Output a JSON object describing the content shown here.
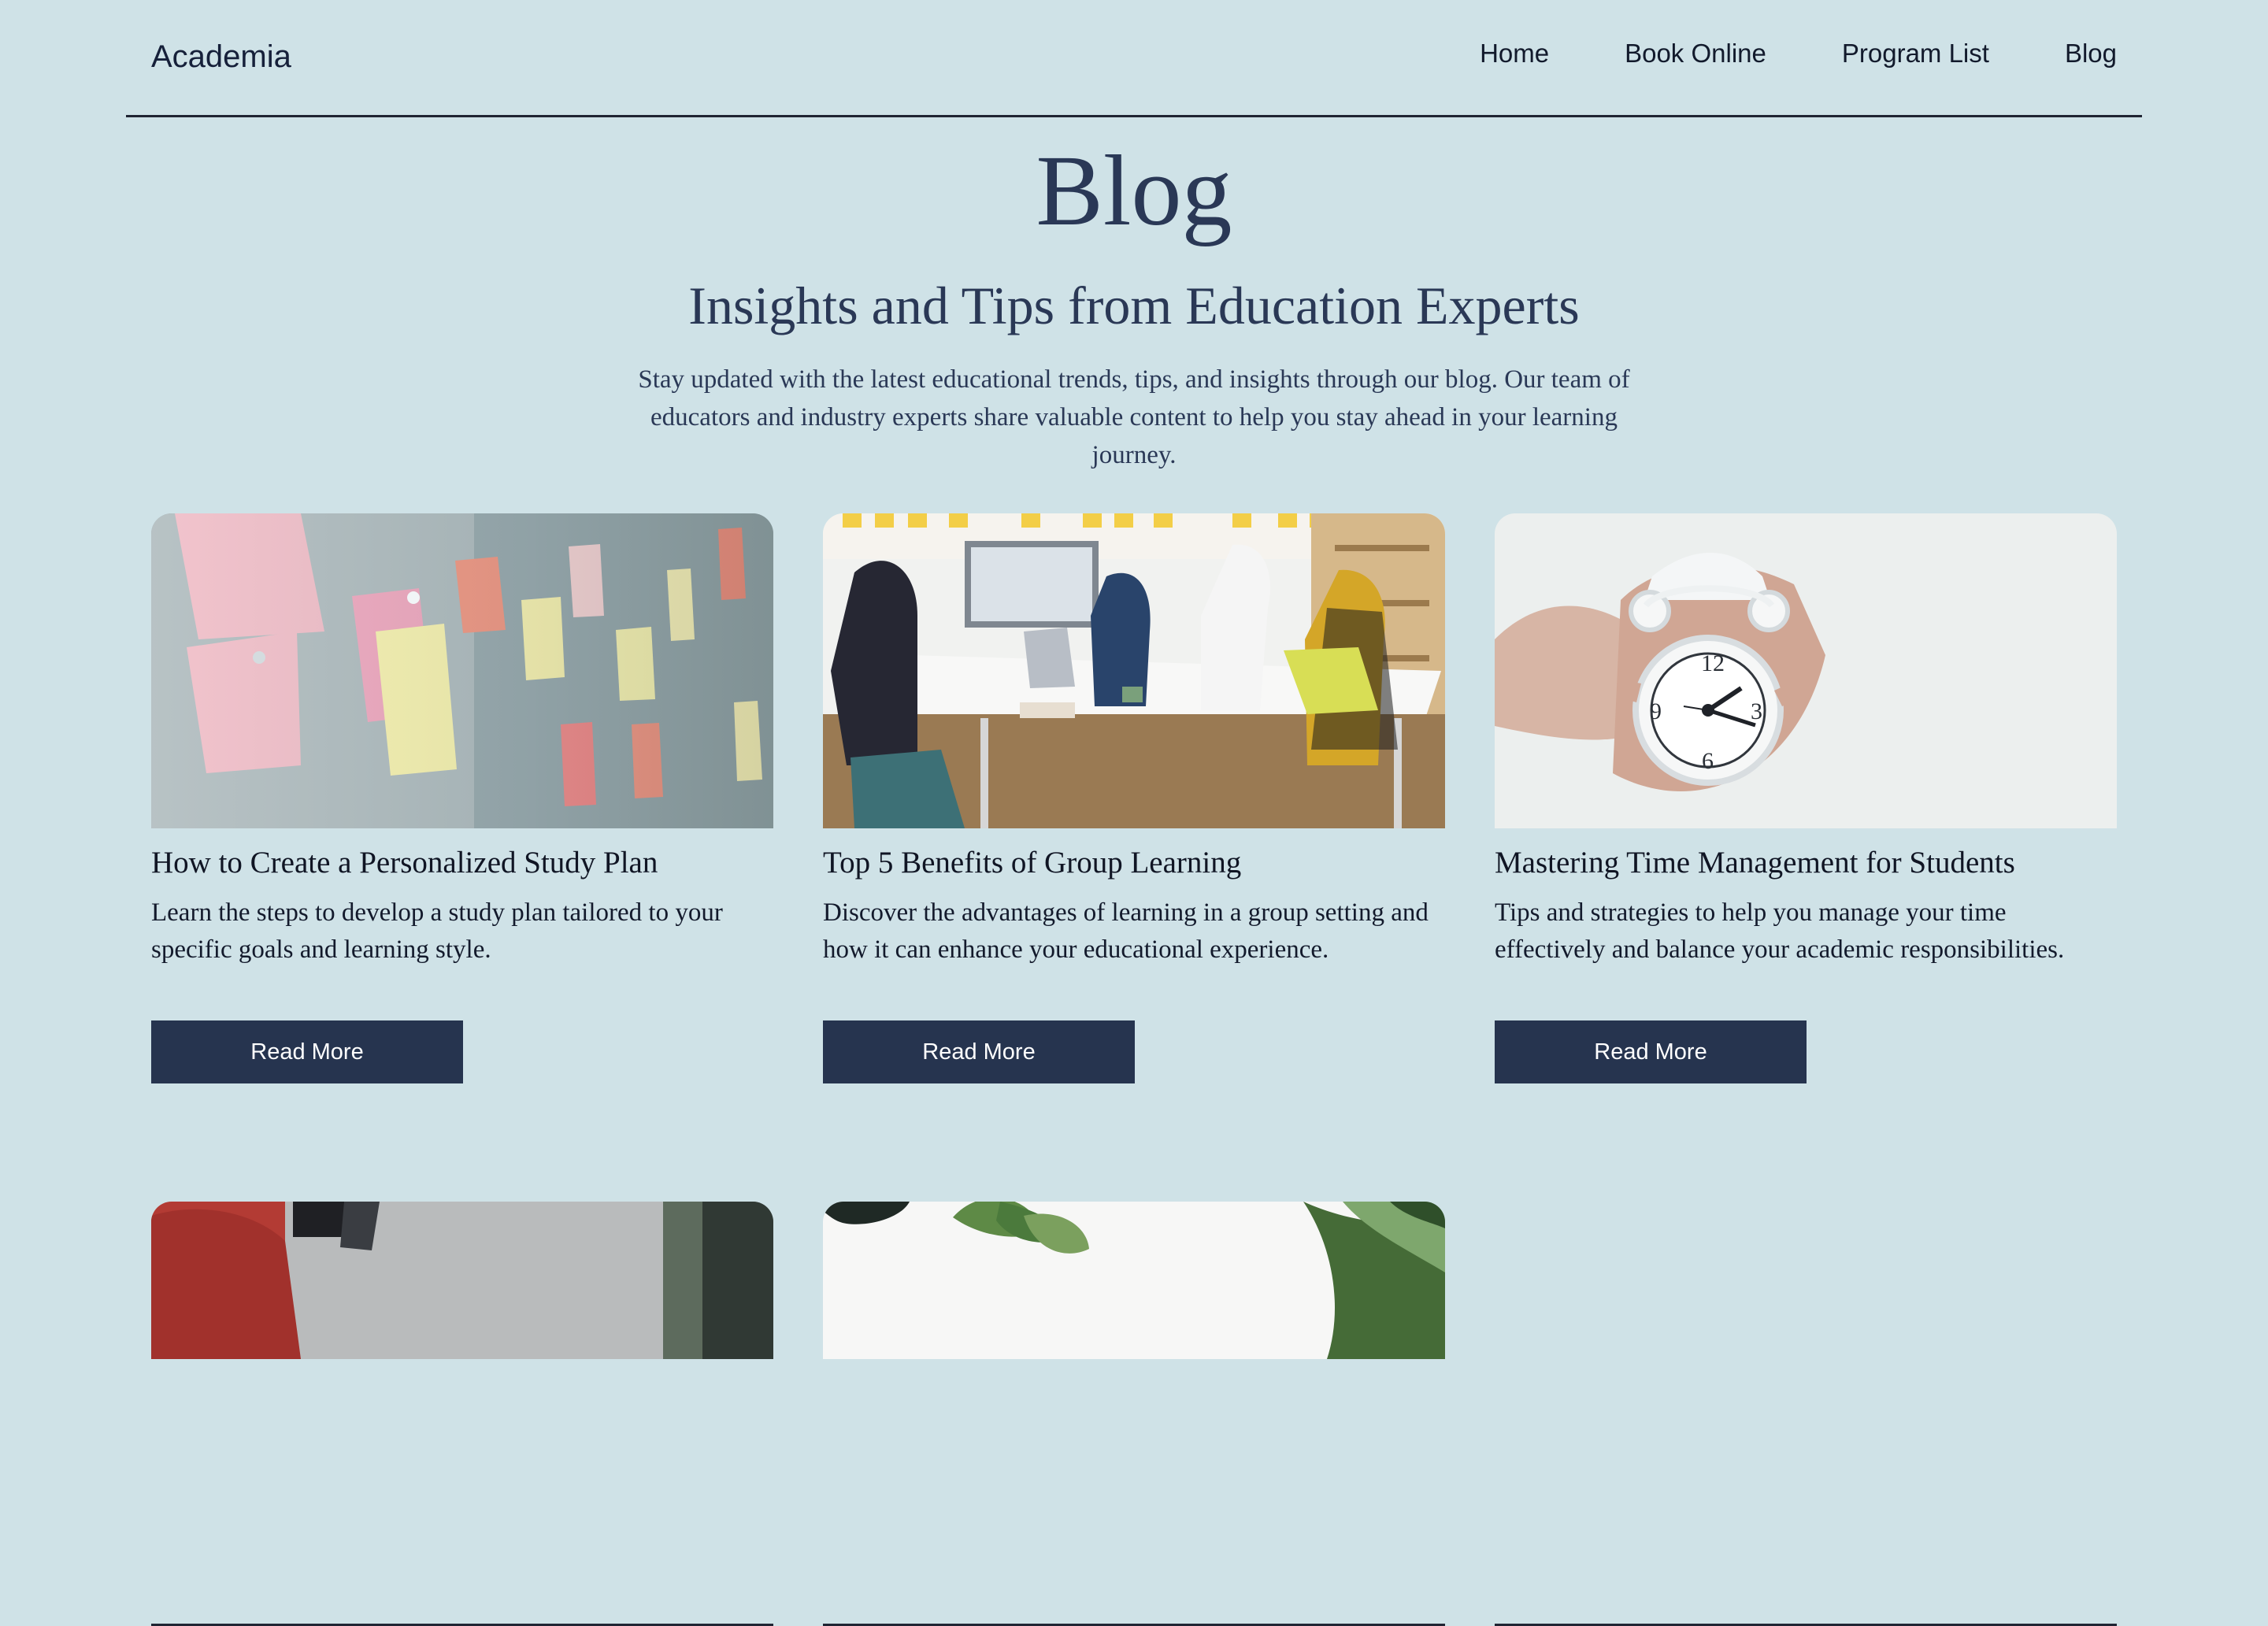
{
  "site": {
    "brand": "Academia"
  },
  "nav": {
    "items": [
      "Home",
      "Book Online",
      "Program List",
      "Blog"
    ]
  },
  "hero": {
    "title": "Blog",
    "subtitle": "Insights and Tips from Education Experts",
    "description": "Stay updated with the latest educational trends, tips, and insights through our blog. Our team of educators and industry experts share valuable content to help you stay ahead in your learning journey."
  },
  "posts": [
    {
      "title": "How to Create a Personalized Study Plan",
      "excerpt": "Learn the steps to develop a study plan tailored to your specific goals and learning style.",
      "button": "Read More"
    },
    {
      "title": "Top 5 Benefits of Group Learning",
      "excerpt": "Discover the advantages of learning in a group setting and how it can enhance your educational experience.",
      "button": "Read More"
    },
    {
      "title": "Mastering Time Management for Students",
      "excerpt": "Tips and strategies to help you manage your time effectively and balance your academic responsibilities.",
      "button": "Read More"
    }
  ],
  "colors": {
    "background": "#cfe2e7",
    "text": "#1f2b43",
    "button": "#26344f"
  },
  "icons": {
    "card_1": "sticky-notes-image",
    "card_2": "group-learning-image",
    "card_3": "alarm-clock-image",
    "card_4": "headphones-image",
    "card_5": "plants-image"
  }
}
